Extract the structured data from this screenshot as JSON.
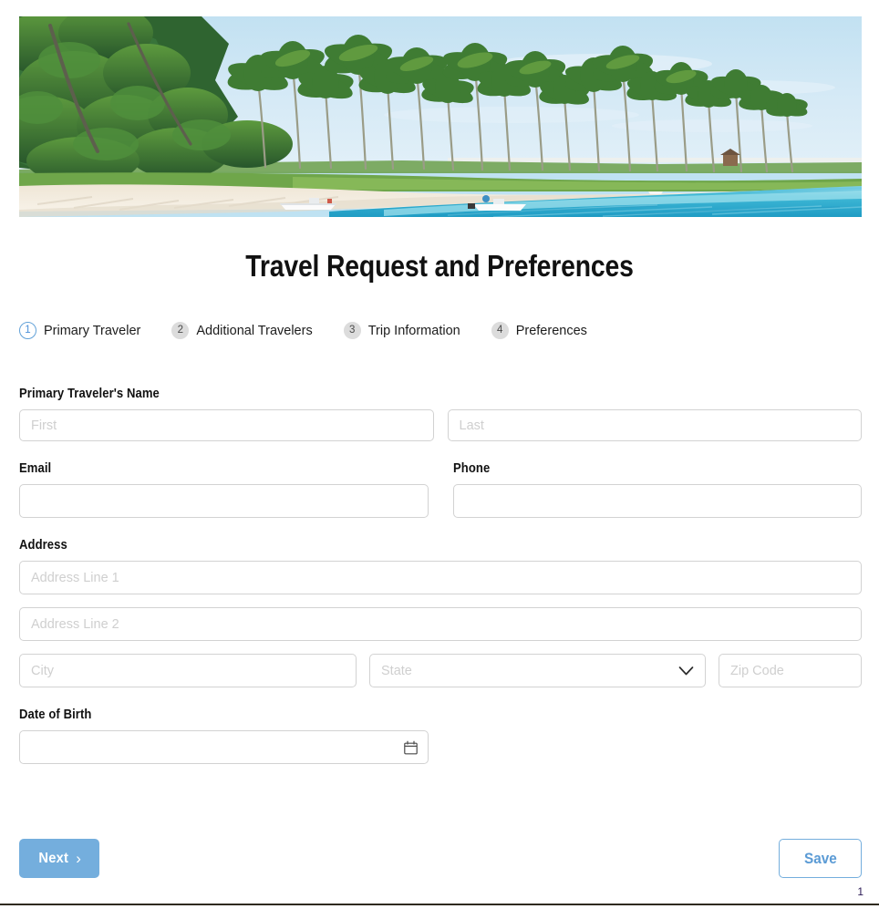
{
  "header": {
    "title": "Travel Request and Preferences"
  },
  "hero": {
    "alt": "Tropical beach with palm trees, white sand and turquoise ocean",
    "icon": "beach-photo",
    "colors": {
      "sky": "#cfe7f4",
      "sky_pale": "#dcedf7",
      "ocean": "#3cb5d4",
      "ocean_deep": "#1f9cc4",
      "shallow": "#9fdcea",
      "sand": "#f2ece1",
      "foliage_dark": "#2f6430",
      "foliage_mid": "#4b8a3a",
      "foliage_light": "#88b94e",
      "trunk": "#6b6f5c"
    }
  },
  "stepper": {
    "steps": [
      {
        "number": "1",
        "label": "Primary Traveler",
        "state": "active"
      },
      {
        "number": "2",
        "label": "Additional Travelers",
        "state": "inactive"
      },
      {
        "number": "3",
        "label": "Trip Information",
        "state": "inactive"
      },
      {
        "number": "4",
        "label": "Preferences",
        "state": "inactive"
      }
    ],
    "active_color": "#4a90d9",
    "inactive_color": "#dcdcdc"
  },
  "form": {
    "name": {
      "label": "Primary Traveler's Name",
      "first": {
        "value": "",
        "placeholder": "First"
      },
      "last": {
        "value": "",
        "placeholder": "Last"
      }
    },
    "email": {
      "label": "Email",
      "value": "",
      "placeholder": ""
    },
    "phone": {
      "label": "Phone",
      "value": "",
      "placeholder": ""
    },
    "address": {
      "label": "Address",
      "line1": {
        "value": "",
        "placeholder": "Address Line 1"
      },
      "line2": {
        "value": "",
        "placeholder": "Address Line 2"
      },
      "city": {
        "value": "",
        "placeholder": "City"
      },
      "state": {
        "value": "",
        "placeholder": "State",
        "icon": "chevron-down-icon"
      },
      "zip": {
        "value": "",
        "placeholder": "Zip Code"
      }
    },
    "dob": {
      "label": "Date of Birth",
      "value": "",
      "placeholder": "",
      "icon": "calendar-icon"
    }
  },
  "actions": {
    "next_label": "Next",
    "next_icon": "chevron-right-icon",
    "next_color": "#74aedd",
    "save_label": "Save",
    "save_color": "#5b9bd5"
  },
  "footer": {
    "page_number": "1"
  }
}
